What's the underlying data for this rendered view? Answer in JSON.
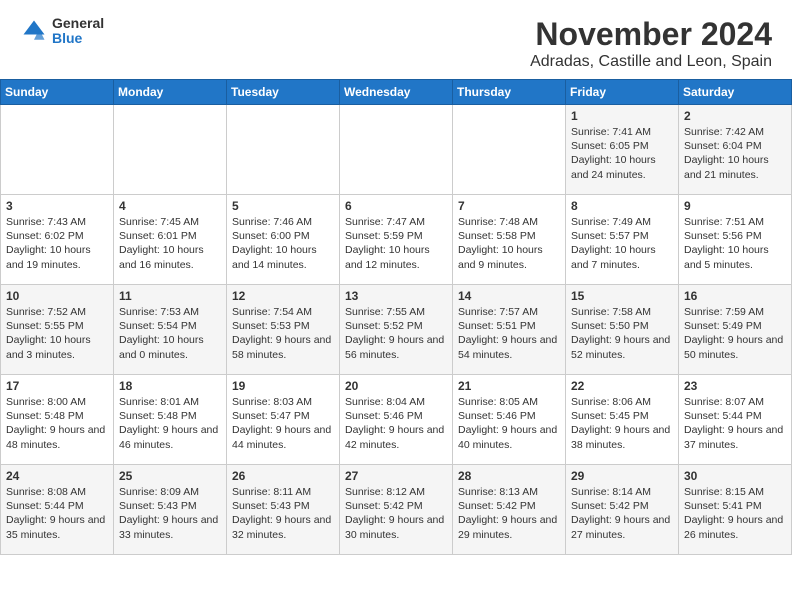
{
  "header": {
    "logo_line1": "General",
    "logo_line2": "Blue",
    "title": "November 2024",
    "subtitle": "Adradas, Castille and Leon, Spain"
  },
  "calendar": {
    "days_of_week": [
      "Sunday",
      "Monday",
      "Tuesday",
      "Wednesday",
      "Thursday",
      "Friday",
      "Saturday"
    ],
    "weeks": [
      [
        {
          "day": "",
          "info": ""
        },
        {
          "day": "",
          "info": ""
        },
        {
          "day": "",
          "info": ""
        },
        {
          "day": "",
          "info": ""
        },
        {
          "day": "",
          "info": ""
        },
        {
          "day": "1",
          "info": "Sunrise: 7:41 AM\nSunset: 6:05 PM\nDaylight: 10 hours and 24 minutes."
        },
        {
          "day": "2",
          "info": "Sunrise: 7:42 AM\nSunset: 6:04 PM\nDaylight: 10 hours and 21 minutes."
        }
      ],
      [
        {
          "day": "3",
          "info": "Sunrise: 7:43 AM\nSunset: 6:02 PM\nDaylight: 10 hours and 19 minutes."
        },
        {
          "day": "4",
          "info": "Sunrise: 7:45 AM\nSunset: 6:01 PM\nDaylight: 10 hours and 16 minutes."
        },
        {
          "day": "5",
          "info": "Sunrise: 7:46 AM\nSunset: 6:00 PM\nDaylight: 10 hours and 14 minutes."
        },
        {
          "day": "6",
          "info": "Sunrise: 7:47 AM\nSunset: 5:59 PM\nDaylight: 10 hours and 12 minutes."
        },
        {
          "day": "7",
          "info": "Sunrise: 7:48 AM\nSunset: 5:58 PM\nDaylight: 10 hours and 9 minutes."
        },
        {
          "day": "8",
          "info": "Sunrise: 7:49 AM\nSunset: 5:57 PM\nDaylight: 10 hours and 7 minutes."
        },
        {
          "day": "9",
          "info": "Sunrise: 7:51 AM\nSunset: 5:56 PM\nDaylight: 10 hours and 5 minutes."
        }
      ],
      [
        {
          "day": "10",
          "info": "Sunrise: 7:52 AM\nSunset: 5:55 PM\nDaylight: 10 hours and 3 minutes."
        },
        {
          "day": "11",
          "info": "Sunrise: 7:53 AM\nSunset: 5:54 PM\nDaylight: 10 hours and 0 minutes."
        },
        {
          "day": "12",
          "info": "Sunrise: 7:54 AM\nSunset: 5:53 PM\nDaylight: 9 hours and 58 minutes."
        },
        {
          "day": "13",
          "info": "Sunrise: 7:55 AM\nSunset: 5:52 PM\nDaylight: 9 hours and 56 minutes."
        },
        {
          "day": "14",
          "info": "Sunrise: 7:57 AM\nSunset: 5:51 PM\nDaylight: 9 hours and 54 minutes."
        },
        {
          "day": "15",
          "info": "Sunrise: 7:58 AM\nSunset: 5:50 PM\nDaylight: 9 hours and 52 minutes."
        },
        {
          "day": "16",
          "info": "Sunrise: 7:59 AM\nSunset: 5:49 PM\nDaylight: 9 hours and 50 minutes."
        }
      ],
      [
        {
          "day": "17",
          "info": "Sunrise: 8:00 AM\nSunset: 5:48 PM\nDaylight: 9 hours and 48 minutes."
        },
        {
          "day": "18",
          "info": "Sunrise: 8:01 AM\nSunset: 5:48 PM\nDaylight: 9 hours and 46 minutes."
        },
        {
          "day": "19",
          "info": "Sunrise: 8:03 AM\nSunset: 5:47 PM\nDaylight: 9 hours and 44 minutes."
        },
        {
          "day": "20",
          "info": "Sunrise: 8:04 AM\nSunset: 5:46 PM\nDaylight: 9 hours and 42 minutes."
        },
        {
          "day": "21",
          "info": "Sunrise: 8:05 AM\nSunset: 5:46 PM\nDaylight: 9 hours and 40 minutes."
        },
        {
          "day": "22",
          "info": "Sunrise: 8:06 AM\nSunset: 5:45 PM\nDaylight: 9 hours and 38 minutes."
        },
        {
          "day": "23",
          "info": "Sunrise: 8:07 AM\nSunset: 5:44 PM\nDaylight: 9 hours and 37 minutes."
        }
      ],
      [
        {
          "day": "24",
          "info": "Sunrise: 8:08 AM\nSunset: 5:44 PM\nDaylight: 9 hours and 35 minutes."
        },
        {
          "day": "25",
          "info": "Sunrise: 8:09 AM\nSunset: 5:43 PM\nDaylight: 9 hours and 33 minutes."
        },
        {
          "day": "26",
          "info": "Sunrise: 8:11 AM\nSunset: 5:43 PM\nDaylight: 9 hours and 32 minutes."
        },
        {
          "day": "27",
          "info": "Sunrise: 8:12 AM\nSunset: 5:42 PM\nDaylight: 9 hours and 30 minutes."
        },
        {
          "day": "28",
          "info": "Sunrise: 8:13 AM\nSunset: 5:42 PM\nDaylight: 9 hours and 29 minutes."
        },
        {
          "day": "29",
          "info": "Sunrise: 8:14 AM\nSunset: 5:42 PM\nDaylight: 9 hours and 27 minutes."
        },
        {
          "day": "30",
          "info": "Sunrise: 8:15 AM\nSunset: 5:41 PM\nDaylight: 9 hours and 26 minutes."
        }
      ]
    ]
  }
}
